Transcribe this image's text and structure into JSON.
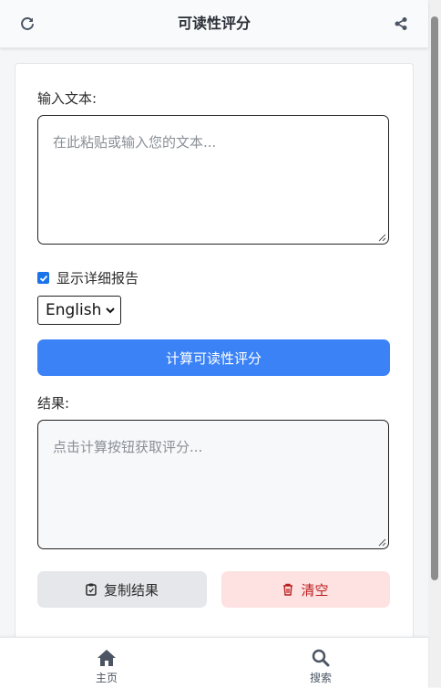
{
  "header": {
    "title": "可读性评分",
    "refresh_icon": "refresh-icon",
    "share_icon": "share-icon"
  },
  "input": {
    "label": "输入文本:",
    "placeholder": "在此粘贴或输入您的文本..."
  },
  "options": {
    "detailed_report_label": "显示详细报告",
    "detailed_report_checked": true,
    "language_selected": "English"
  },
  "actions": {
    "calculate_label": "计算可读性评分",
    "copy_label": "复制结果",
    "clear_label": "清空"
  },
  "result": {
    "label": "结果:",
    "placeholder": "点击计算按钮获取评分..."
  },
  "bottom_nav": {
    "items": [
      {
        "label": "主页",
        "icon": "home-icon"
      },
      {
        "label": "搜索",
        "icon": "search-icon"
      }
    ]
  },
  "colors": {
    "primary": "#3b82f6",
    "danger_bg": "#fee2e2",
    "danger_text": "#b91c1c",
    "neutral_bg": "#e5e7eb"
  }
}
